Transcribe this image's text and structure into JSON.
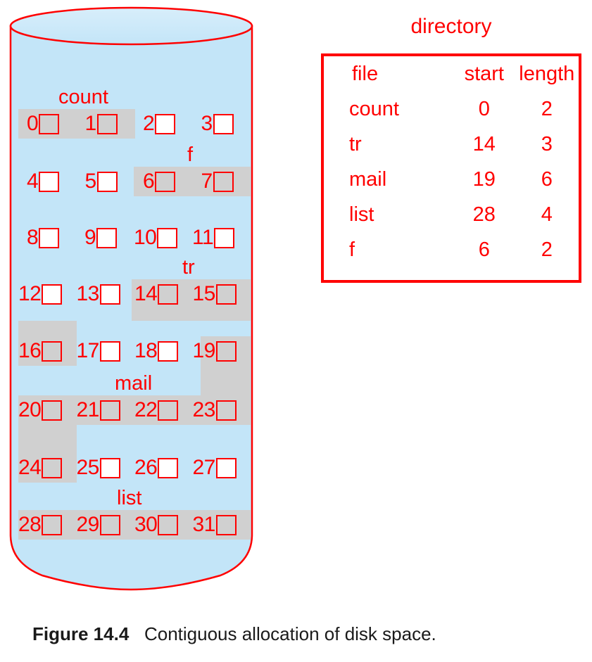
{
  "figure": {
    "caption_label": "Figure 14.4",
    "caption_text": "Contiguous allocation of disk space."
  },
  "disk": {
    "name": "disk-cylinder",
    "fill_color": "#c3e5f8",
    "stroke_color": "#ff0000",
    "block_color": "#ff0000",
    "allocated_color": "#d0d0d0",
    "blocks_per_row": 4,
    "total_blocks": 32,
    "block_numbers": [
      [
        "0",
        "1",
        "2",
        "3"
      ],
      [
        "4",
        "5",
        "6",
        "7"
      ],
      [
        "8",
        "9",
        "10",
        "11"
      ],
      [
        "12",
        "13",
        "14",
        "15"
      ],
      [
        "16",
        "17",
        "18",
        "19"
      ],
      [
        "20",
        "21",
        "22",
        "23"
      ],
      [
        "24",
        "25",
        "26",
        "27"
      ],
      [
        "28",
        "29",
        "30",
        "31"
      ]
    ],
    "labels": [
      {
        "name": "count",
        "text": "count"
      },
      {
        "name": "f",
        "text": "f"
      },
      {
        "name": "tr",
        "text": "tr"
      },
      {
        "name": "mail",
        "text": "mail"
      },
      {
        "name": "list",
        "text": "list"
      }
    ]
  },
  "directory": {
    "title": "directory",
    "columns": [
      "file",
      "start",
      "length"
    ],
    "rows": [
      {
        "file": "count",
        "start": "0",
        "length": "2"
      },
      {
        "file": "tr",
        "start": "14",
        "length": "3"
      },
      {
        "file": "mail",
        "start": "19",
        "length": "6"
      },
      {
        "file": "list",
        "start": "28",
        "length": "4"
      },
      {
        "file": "f",
        "start": "6",
        "length": "2"
      }
    ]
  },
  "chart_data": {
    "type": "diagram",
    "title": "Contiguous allocation of disk space",
    "disk_blocks": 32,
    "allocations": [
      {
        "file": "count",
        "start": 0,
        "length": 2,
        "blocks": [
          0,
          1
        ]
      },
      {
        "file": "f",
        "start": 6,
        "length": 2,
        "blocks": [
          6,
          7
        ]
      },
      {
        "file": "tr",
        "start": 14,
        "length": 3,
        "blocks": [
          14,
          15,
          16
        ]
      },
      {
        "file": "mail",
        "start": 19,
        "length": 6,
        "blocks": [
          19,
          20,
          21,
          22,
          23,
          24
        ]
      },
      {
        "file": "list",
        "start": 28,
        "length": 4,
        "blocks": [
          28,
          29,
          30,
          31
        ]
      }
    ],
    "free_blocks": [
      2,
      3,
      4,
      5,
      8,
      9,
      10,
      11,
      12,
      13,
      17,
      18,
      25,
      26,
      27
    ]
  }
}
